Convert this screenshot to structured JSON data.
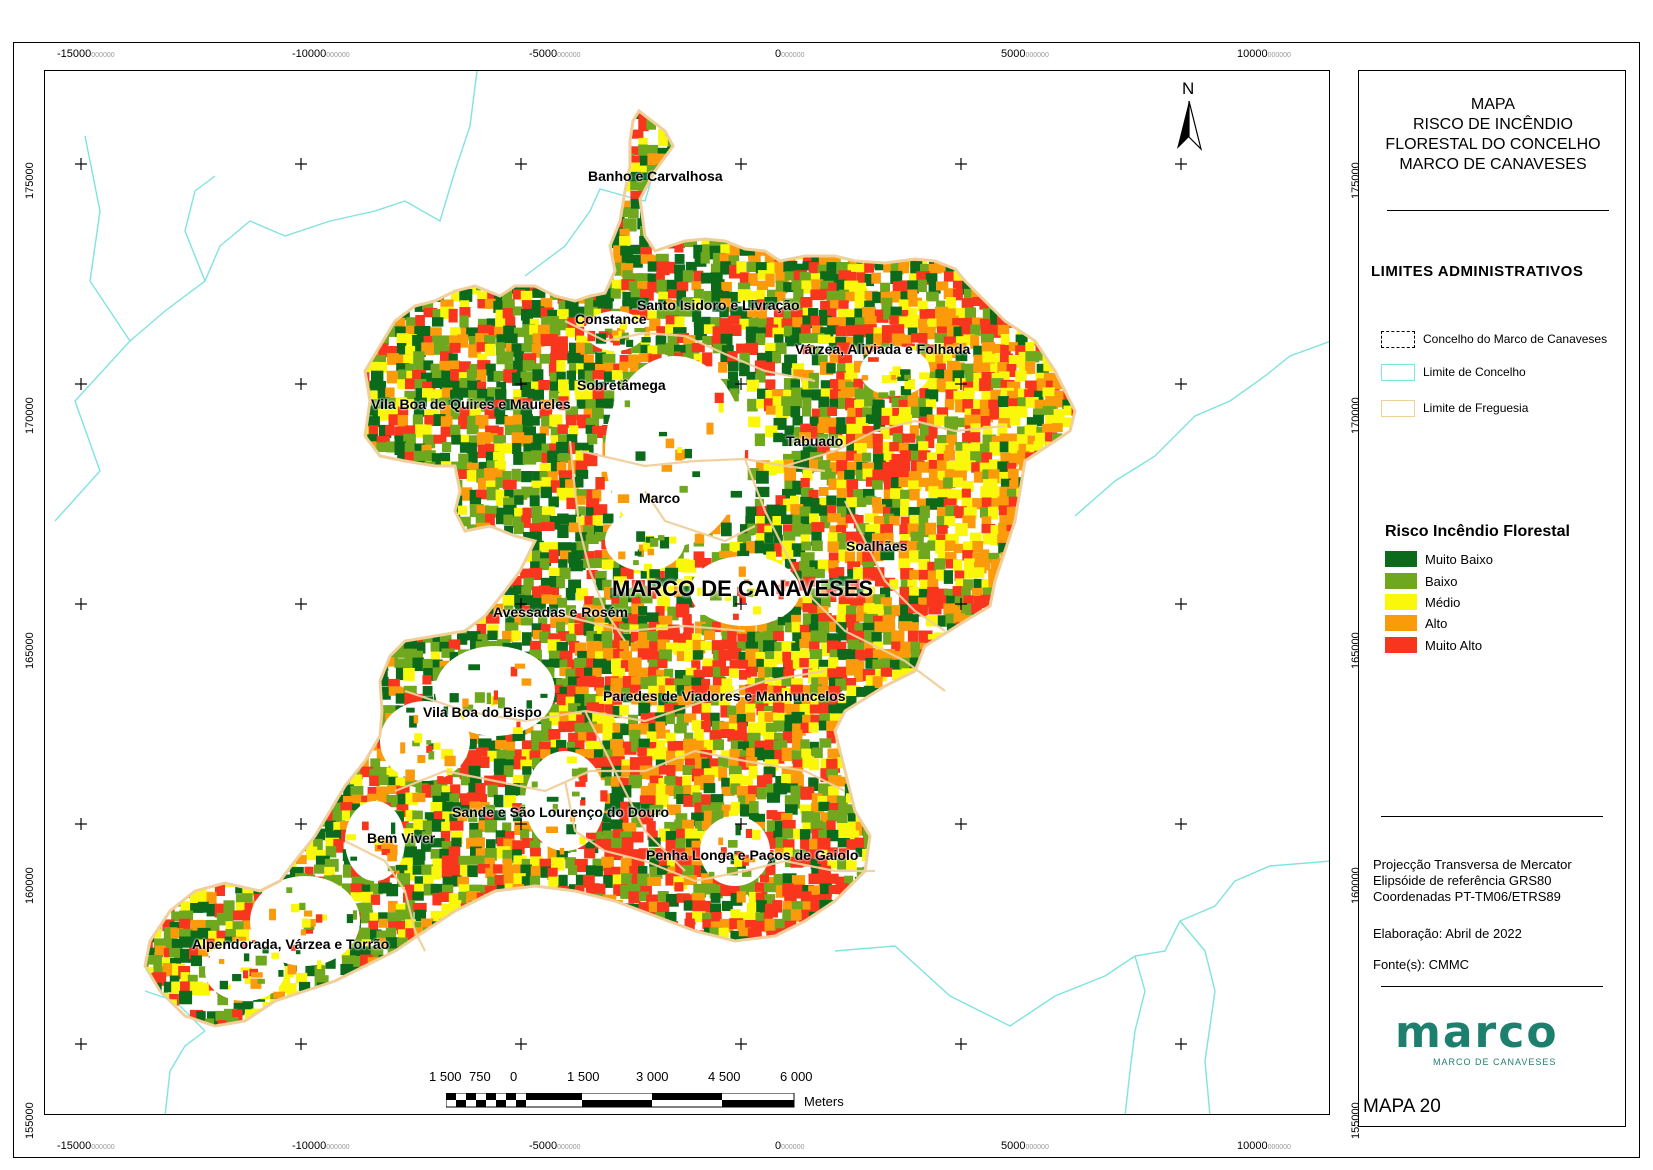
{
  "frame_coords": {
    "x_labels": [
      {
        "main": "-15000",
        "sub": "000000"
      },
      {
        "main": "-10000",
        "sub": "000000"
      },
      {
        "main": "-5000",
        "sub": "000000"
      },
      {
        "main": "0",
        "sub": "000000"
      },
      {
        "main": "5000",
        "sub": "000000"
      },
      {
        "main": "10000",
        "sub": "000000"
      }
    ],
    "y_labels": [
      "175000",
      "170000",
      "165000",
      "160000",
      "155000"
    ]
  },
  "title": {
    "line1": "MAPA",
    "line2": "RISCO DE INCÊNDIO",
    "line3": "FLORESTAL DO CONCELHO",
    "line4": "MARCO DE CANAVESES"
  },
  "limites": {
    "heading": "LIMITES ADMINISTRATIVOS",
    "items": [
      {
        "label": "Concelho do Marco de Canaveses",
        "style": "dashed-black"
      },
      {
        "label": "Limite de Concelho",
        "color": "#7fe3e0"
      },
      {
        "label": "Limite de Freguesia",
        "color": "#f0cf9a"
      }
    ]
  },
  "risco": {
    "heading": "Risco Incêndio Florestal",
    "classes": [
      {
        "label": "Muito Baixo",
        "color": "#0c6a1b"
      },
      {
        "label": "Baixo",
        "color": "#6fa81e"
      },
      {
        "label": "Médio",
        "color": "#fbf70a"
      },
      {
        "label": "Alto",
        "color": "#fb9a0a"
      },
      {
        "label": "Muito Alto",
        "color": "#f8361d"
      }
    ]
  },
  "metadata": {
    "projection": "Projecção Transversa de Mercator",
    "ellipsoid": "Elipsóide de referência GRS80",
    "coords": "Coordenadas PT-TM06/ETRS89",
    "elaboracao": "Elaboração: Abril de 2022",
    "fonte": "Fonte(s): CMMC"
  },
  "logo": {
    "text": "marco",
    "subtext": "MARCO DE CANAVESES",
    "color": "#1d7f6e"
  },
  "map_number": "MAPA 20",
  "north_label": "N",
  "municipality_label": "MARCO DE CANAVESES",
  "parishes": [
    "Banho e Carvalhosa",
    "Santo Isidoro e Livração",
    "Constance",
    "Várzea, Aliviada e Folhada",
    "Sobretâmega",
    "Vila Boa de Quires e Maureles",
    "Tabuado",
    "Marco",
    "Soalhães",
    "Avessadas e Rosém",
    "Paredes de Viadores e Manhuncelos",
    "Vila Boa do Bispo",
    "Sande e São Lourenço do Douro",
    "Bem Viver",
    "Penha Longa e Paços de Gaiolo",
    "Alpendorada, Várzea e Torrão"
  ],
  "scale": {
    "labels": [
      "1 500",
      "750",
      "0",
      "1 500",
      "3 000",
      "4 500",
      "6 000"
    ],
    "unit": "Meters"
  }
}
